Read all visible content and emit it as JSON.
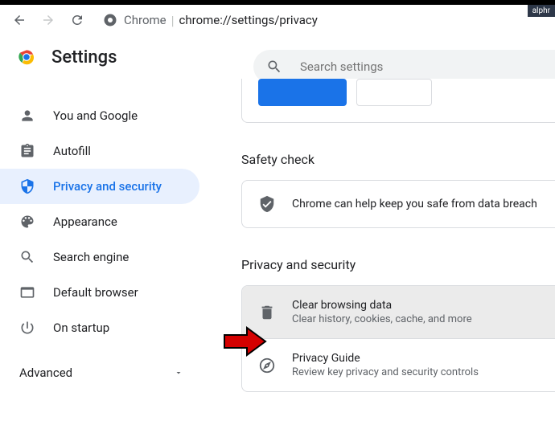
{
  "watermark": "alphr",
  "url": {
    "scheme": "Chrome",
    "path": "chrome://settings/privacy"
  },
  "header": {
    "title": "Settings"
  },
  "search": {
    "placeholder": "Search settings"
  },
  "sidebar": {
    "items": [
      {
        "label": "You and Google"
      },
      {
        "label": "Autofill"
      },
      {
        "label": "Privacy and security"
      },
      {
        "label": "Appearance"
      },
      {
        "label": "Search engine"
      },
      {
        "label": "Default browser"
      },
      {
        "label": "On startup"
      }
    ],
    "advanced": "Advanced"
  },
  "content": {
    "safety_section": "Safety check",
    "safety_text": "Chrome can help keep you safe from data breach",
    "privacy_section": "Privacy and security",
    "privacy_items": [
      {
        "title": "Clear browsing data",
        "desc": "Clear history, cookies, cache, and more"
      },
      {
        "title": "Privacy Guide",
        "desc": "Review key privacy and security controls"
      }
    ]
  }
}
